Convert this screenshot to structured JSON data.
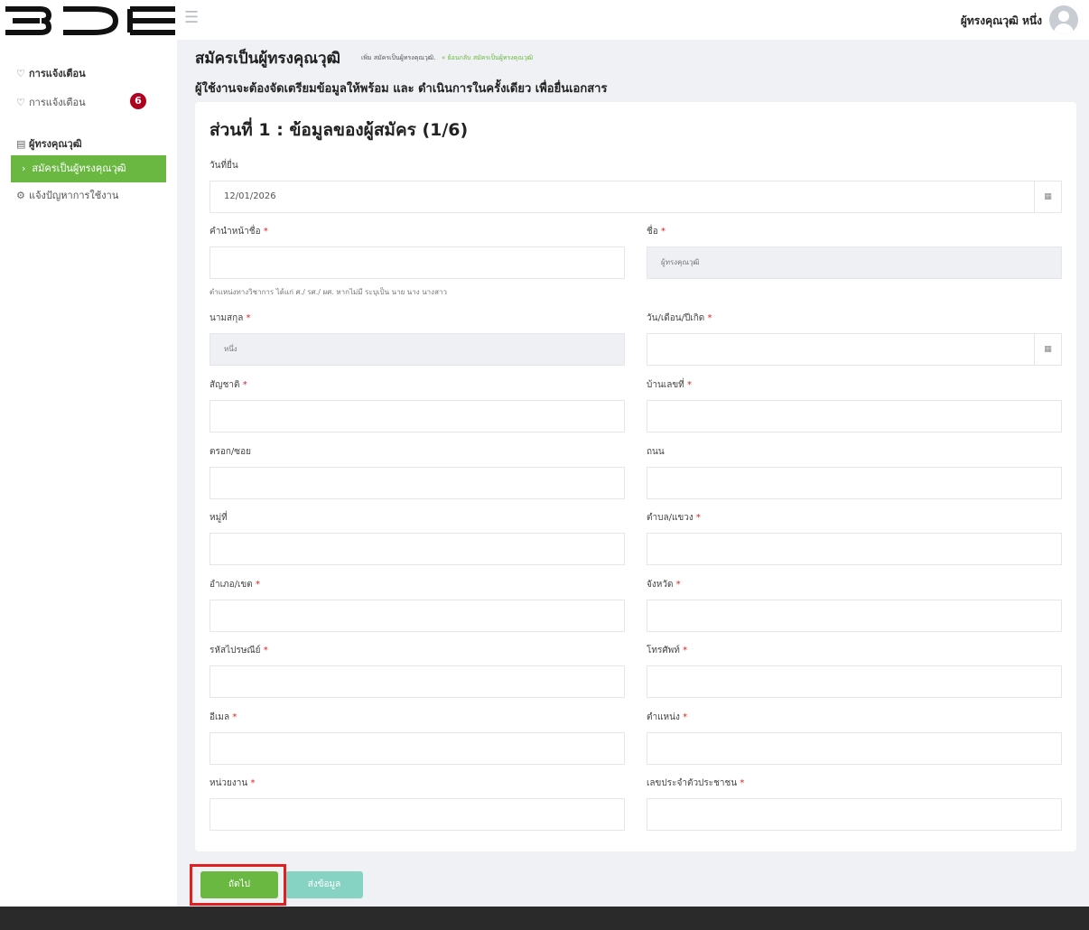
{
  "header": {
    "logo_text": "BDE",
    "menu_icon": "hamburger-icon",
    "user_name": "ผู้ทรงคุณวุฒิ หนึ่ง",
    "avatar_icon": "user-avatar-icon"
  },
  "sidebar": {
    "section1_title": "การแจ้งเตือน",
    "notify_item": "การแจ้งเตือน",
    "notify_badge": "6",
    "section2_title": "ผู้ทรงคุณวุฒิ",
    "active_item": "สมัครเป็นผู้ทรงคุณวุฒิ",
    "report_item": "แจ้งปัญหาการใช้งาน"
  },
  "page": {
    "title": "สมัครเป็นผู้ทรงคุณวุฒิ",
    "crumb_current": "เพิ่ม สมัครเป็นผู้ทรงคุณวุฒิ.",
    "crumb_back": "« ย้อนกลับ สมัครเป็นผู้ทรงคุณวุฒิ",
    "subtitle": "ผู้ใช้งานจะต้องจัดเตรียมข้อมูลให้พร้อม และ ดำเนินการในครั้งเดียว เพื่อยื่นเอกสาร"
  },
  "form": {
    "section_title": "ส่วนที่ 1 : ข้อมูลของผู้สมัคร (1/6)",
    "required_mark": "*",
    "fields": {
      "submit_date": {
        "label": "วันที่ยื่น",
        "value": "12/01/2026"
      },
      "prefix": {
        "label": "คำนำหน้าชื่อ",
        "value": "",
        "hint": "ตำแหน่งทางวิชาการ ได้แก่ ศ./ รศ./ ผศ. หากไม่มี ระบุเป็น นาย นาง นางสาว"
      },
      "first_name": {
        "label": "ชื่อ",
        "value": "ผู้ทรงคุณวุฒิ"
      },
      "last_name": {
        "label": "นามสกุล",
        "value": "หนึ่ง"
      },
      "birth_date": {
        "label": "วัน/เดือน/ปีเกิด",
        "value": ""
      },
      "nationality": {
        "label": "สัญชาติ",
        "value": ""
      },
      "house_no": {
        "label": "บ้านเลขที่",
        "value": ""
      },
      "alley": {
        "label": "ตรอก/ซอย",
        "value": ""
      },
      "road": {
        "label": "ถนน",
        "value": ""
      },
      "village_no": {
        "label": "หมู่ที่",
        "value": ""
      },
      "subdistrict": {
        "label": "ตำบล/แขวง",
        "value": ""
      },
      "district": {
        "label": "อำเภอ/เขต",
        "value": ""
      },
      "province": {
        "label": "จังหวัด",
        "value": ""
      },
      "postal_code": {
        "label": "รหัสไปรษณีย์",
        "value": ""
      },
      "phone": {
        "label": "โทรศัพท์",
        "value": ""
      },
      "email": {
        "label": "อีเมล",
        "value": ""
      },
      "position": {
        "label": "ตำแหน่ง",
        "value": ""
      },
      "organization": {
        "label": "หน่วยงาน",
        "value": ""
      },
      "citizen_id": {
        "label": "เลขประจำตัวประชาชน",
        "value": ""
      }
    }
  },
  "actions": {
    "next_label": "ถัดไป",
    "submit_label": "ส่งข้อมูล"
  },
  "colors": {
    "accent": "#6ab842",
    "submit_disabled": "#86d3c4",
    "required": "#e02020",
    "badge": "#b00020"
  }
}
